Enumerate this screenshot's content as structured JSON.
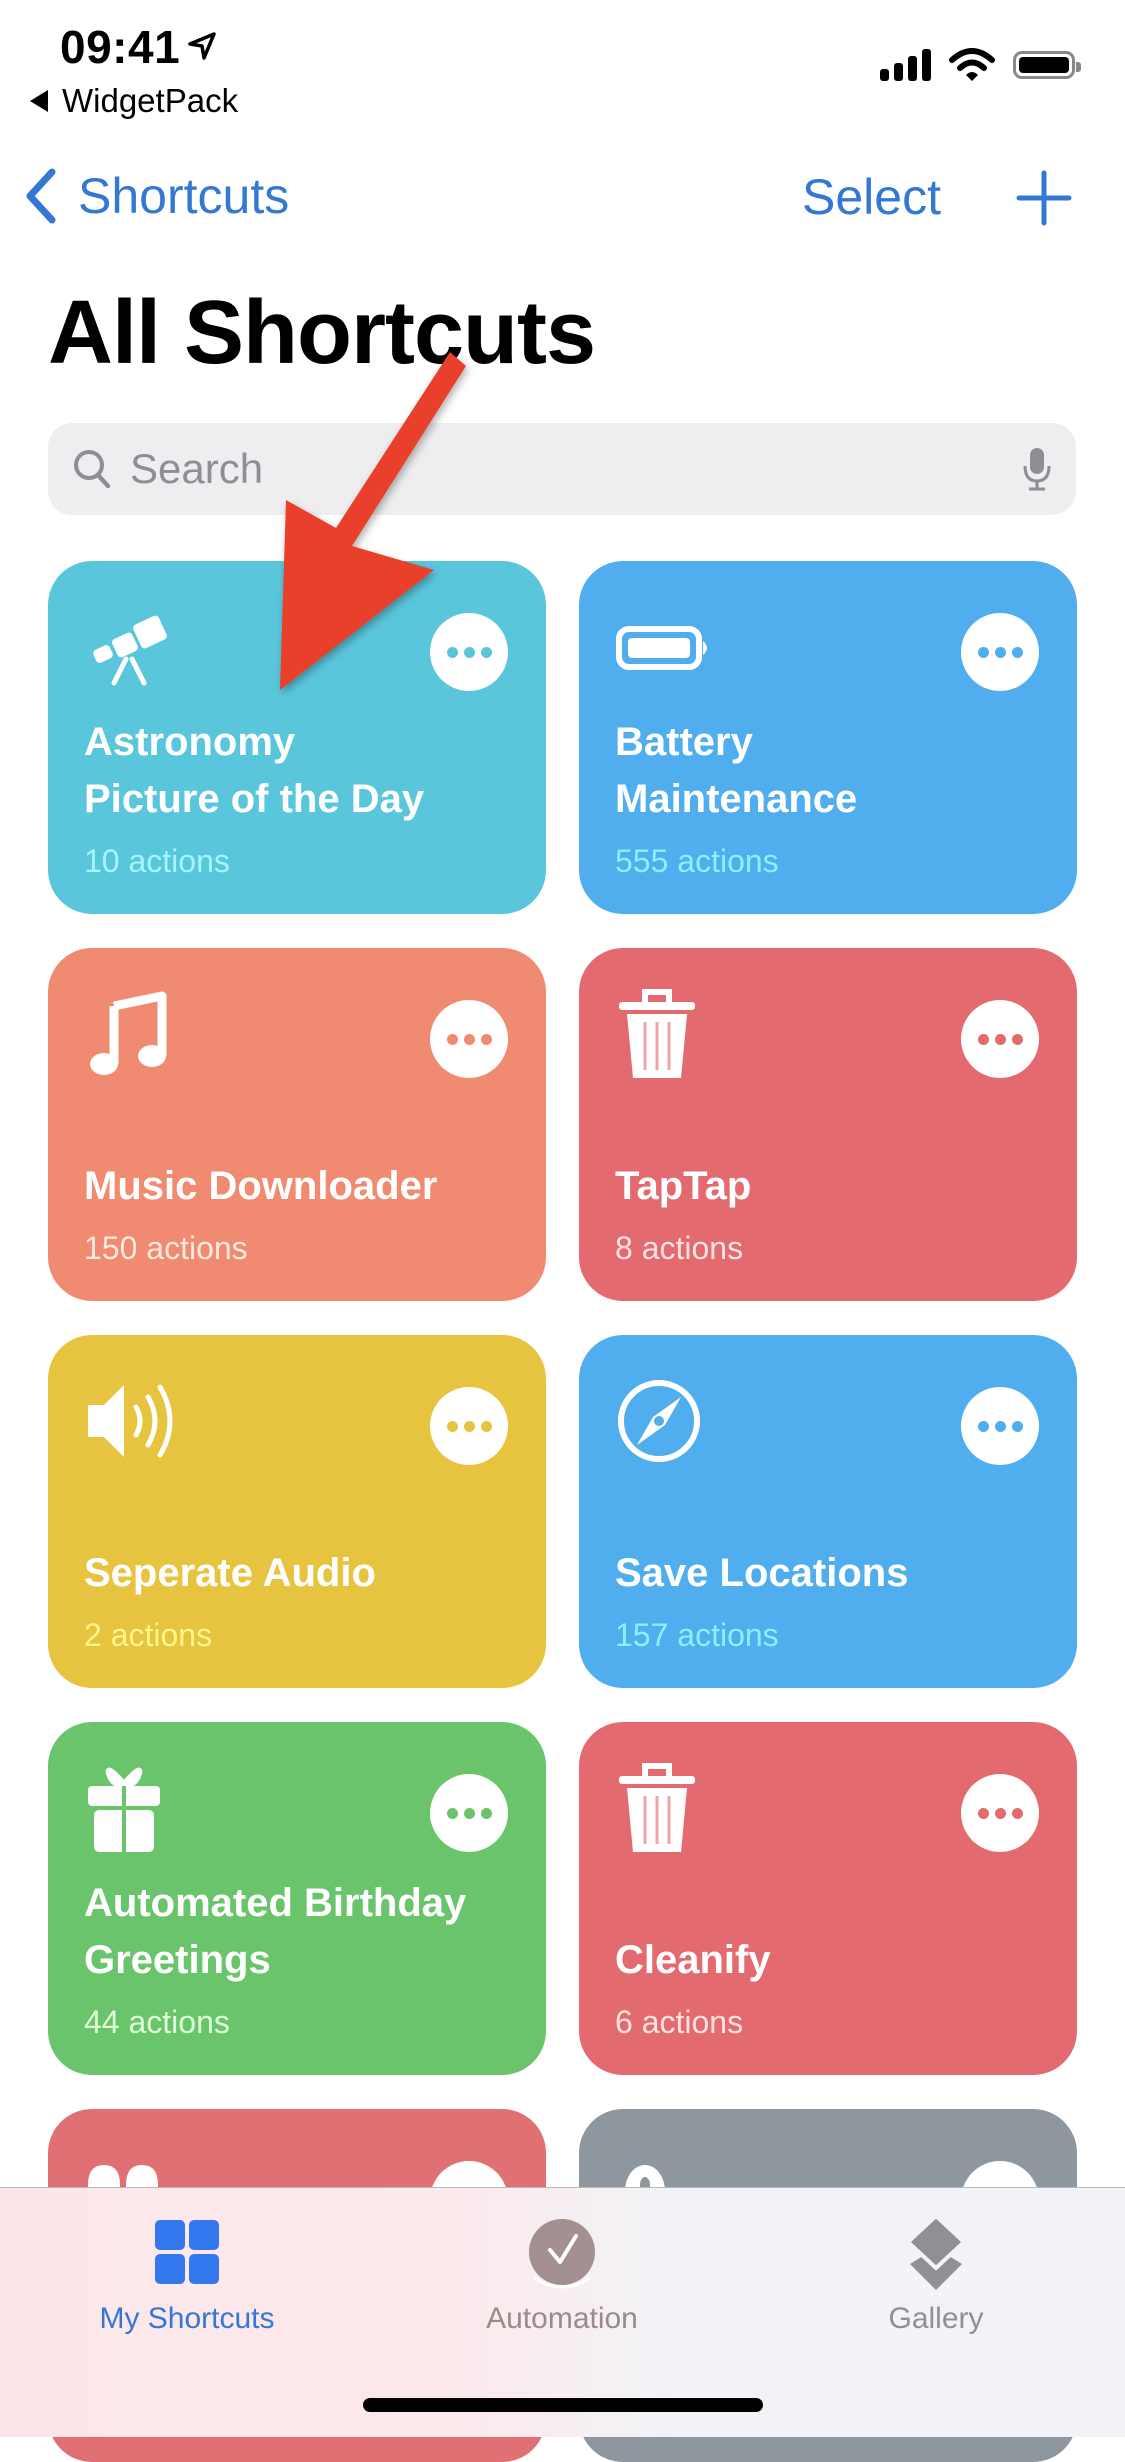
{
  "status_bar": {
    "time": "09:41",
    "back_app": "WidgetPack",
    "icons": [
      "location-arrow-icon",
      "signal-icon",
      "wifi-icon",
      "battery-icon"
    ]
  },
  "nav": {
    "back_label": "Shortcuts",
    "select_label": "Select",
    "add_icon": "plus-icon"
  },
  "page": {
    "title": "All Shortcuts"
  },
  "search": {
    "placeholder": "Search",
    "value": ""
  },
  "colors": {
    "accent": "#3478d6",
    "annotation_arrow": "#e8412a"
  },
  "shortcuts": [
    {
      "title": "Astronomy Picture of the Day",
      "count": "10 actions",
      "icon": "telescope-icon",
      "color": "#5ac6dc",
      "count_color": "#a6f4ff"
    },
    {
      "title": "Battery Maintenance",
      "count": "555 actions",
      "icon": "battery-icon",
      "color": "#50adee",
      "count_color": "#8cf0ff"
    },
    {
      "title": "Music Downloader",
      "count": "150 actions",
      "icon": "music-note-icon",
      "color": "#f08a70",
      "count_color": "#ffe9de"
    },
    {
      "title": "TapTap",
      "count": "8 actions",
      "icon": "trash-icon",
      "color": "#e36a6e",
      "count_color": "#ffe3e4"
    },
    {
      "title": "Seperate Audio",
      "count": "2 actions",
      "icon": "speaker-icon",
      "color": "#e7c440",
      "count_color": "#fff68a"
    },
    {
      "title": "Save Locations",
      "count": "157 actions",
      "icon": "compass-icon",
      "color": "#50adee",
      "count_color": "#8cf0ff"
    },
    {
      "title": "Automated Birthday Greetings",
      "count": "44 actions",
      "icon": "gift-icon",
      "color": "#6ac46c",
      "count_color": "#dcffd8"
    },
    {
      "title": "Cleanify",
      "count": "6 actions",
      "icon": "trash-icon",
      "color": "#e36a6e",
      "count_color": "#ffe3e4"
    },
    {
      "title": "",
      "count": "",
      "icon": "book-icon",
      "color": "#e07073",
      "count_color": "#ffe3e4"
    },
    {
      "title": "",
      "count": "",
      "icon": "person-icon",
      "color": "#8e969e",
      "count_color": "#eeeeee"
    }
  ],
  "tabbar": {
    "tabs": [
      {
        "label": "My Shortcuts",
        "icon": "grid-icon",
        "active": true
      },
      {
        "label": "Automation",
        "icon": "clock-check-icon",
        "active": false
      },
      {
        "label": "Gallery",
        "icon": "layers-icon",
        "active": false
      }
    ]
  }
}
